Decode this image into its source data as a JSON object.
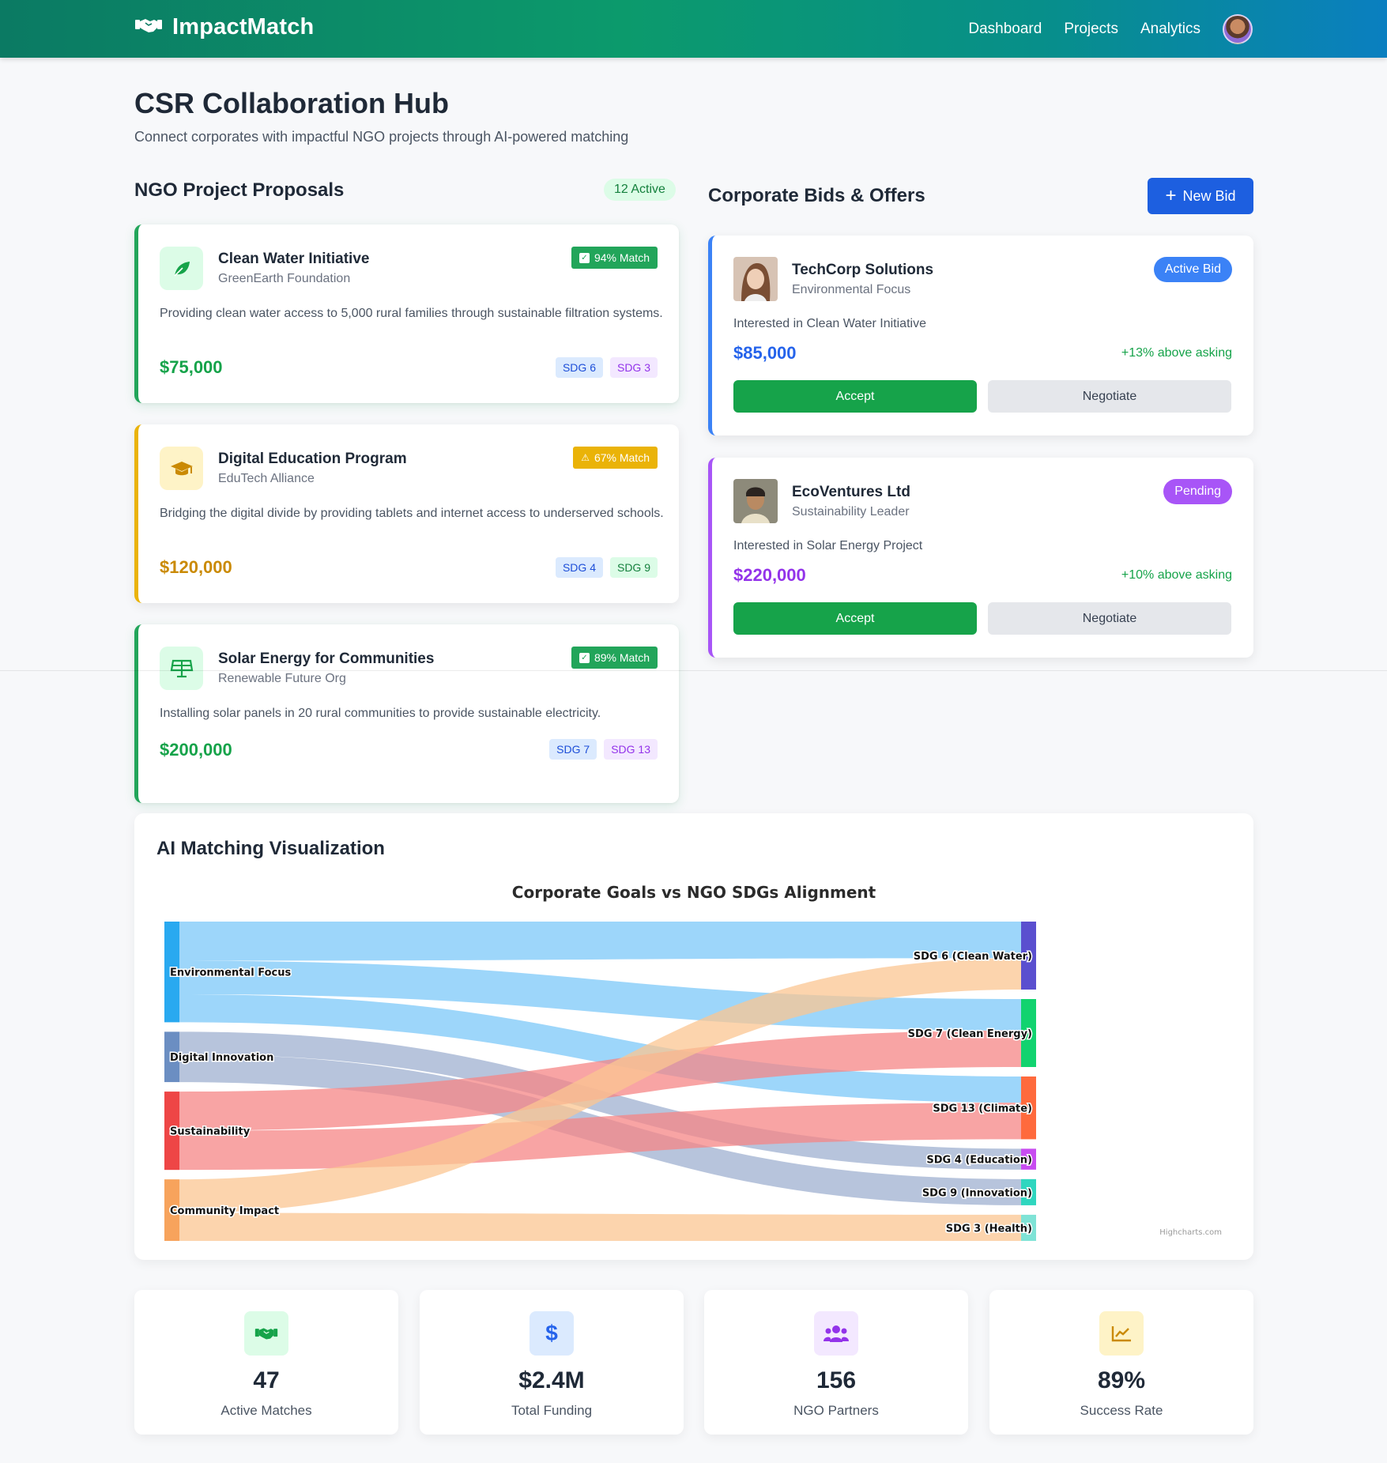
{
  "navbar": {
    "brand": "ImpactMatch",
    "links": [
      "Dashboard",
      "Projects",
      "Analytics"
    ]
  },
  "header": {
    "title": "CSR Collaboration Hub",
    "subtitle": "Connect corporates with impactful NGO projects through AI-powered matching"
  },
  "ngo_section": {
    "title": "NGO Project Proposals",
    "active_pill": "12 Active",
    "cards": [
      {
        "name": "Clean Water Initiative",
        "org": "GreenEarth Foundation",
        "match": "94% Match",
        "description": "Providing clean water access to 5,000 rural families through sustainable filtration systems.",
        "amount": "$75,000",
        "sdgs": [
          "SDG 6",
          "SDG 3"
        ],
        "accent": "#16a34a",
        "icon": "leaf-icon"
      },
      {
        "name": "Digital Education Program",
        "org": "EduTech Alliance",
        "match": "67% Match",
        "description": "Bridging the digital divide by providing tablets and internet access to underserved schools.",
        "amount": "$120,000",
        "sdgs": [
          "SDG 4",
          "SDG 9"
        ],
        "accent": "#ca8a04",
        "icon": "graduation-cap-icon"
      },
      {
        "name": "Solar Energy for Communities",
        "org": "Renewable Future Org",
        "match": "89% Match",
        "description": "Installing solar panels in 20 rural communities to provide sustainable electricity.",
        "amount": "$200,000",
        "sdgs": [
          "SDG 7",
          "SDG 13"
        ],
        "accent": "#16a34a",
        "icon": "solar-panel-icon"
      }
    ]
  },
  "bids_section": {
    "title": "Corporate Bids & Offers",
    "new_bid_label": "New Bid",
    "cards": [
      {
        "company": "TechCorp Solutions",
        "focus": "Environmental Focus",
        "status": "Active Bid",
        "interest": "Interested in Clean Water Initiative",
        "amount": "$85,000",
        "delta": "+13% above asking",
        "accept_label": "Accept",
        "negotiate_label": "Negotiate",
        "accent": "#2563eb"
      },
      {
        "company": "EcoVentures Ltd",
        "focus": "Sustainability Leader",
        "status": "Pending",
        "interest": "Interested in Solar Energy Project",
        "amount": "$220,000",
        "delta": "+10% above asking",
        "accept_label": "Accept",
        "negotiate_label": "Negotiate",
        "accent": "#9333ea"
      }
    ]
  },
  "visualization": {
    "section_title": "AI Matching Visualization",
    "credit": "Highcharts.com"
  },
  "chart_data": {
    "type": "sankey",
    "title": "Corporate Goals vs NGO SDGs Alignment",
    "nodes_left": [
      {
        "name": "Environmental Focus",
        "color": "#29a9f0"
      },
      {
        "name": "Digital Innovation",
        "color": "#6b8ec2"
      },
      {
        "name": "Sustainability",
        "color": "#ee4646"
      },
      {
        "name": "Community Impact",
        "color": "#f7a35c"
      }
    ],
    "nodes_right": [
      {
        "name": "SDG 6 (Clean Water)",
        "color": "#5a4fcf"
      },
      {
        "name": "SDG 7 (Clean Energy)",
        "color": "#12d36f"
      },
      {
        "name": "SDG 13 (Climate)",
        "color": "#ff6a3d"
      },
      {
        "name": "SDG 4 (Education)",
        "color": "#c84cf0"
      },
      {
        "name": "SDG 9 (Innovation)",
        "color": "#2fd6bf"
      },
      {
        "name": "SDG 3 (Health)",
        "color": "#7fe3d6"
      }
    ],
    "links": [
      {
        "from": "Environmental Focus",
        "to": "SDG 6 (Clean Water)",
        "value": 35
      },
      {
        "from": "Environmental Focus",
        "to": "SDG 7 (Clean Energy)",
        "value": 30
      },
      {
        "from": "Environmental Focus",
        "to": "SDG 13 (Climate)",
        "value": 25
      },
      {
        "from": "Digital Innovation",
        "to": "SDG 4 (Education)",
        "value": 20
      },
      {
        "from": "Digital Innovation",
        "to": "SDG 9 (Innovation)",
        "value": 25
      },
      {
        "from": "Sustainability",
        "to": "SDG 7 (Clean Energy)",
        "value": 35
      },
      {
        "from": "Sustainability",
        "to": "SDG 13 (Climate)",
        "value": 35
      },
      {
        "from": "Community Impact",
        "to": "SDG 6 (Clean Water)",
        "value": 30
      },
      {
        "from": "Community Impact",
        "to": "SDG 3 (Health)",
        "value": 25
      }
    ]
  },
  "stats": [
    {
      "value": "47",
      "label": "Active Matches",
      "icon": "handshake-icon"
    },
    {
      "value": "$2.4M",
      "label": "Total Funding",
      "icon": "dollar-icon"
    },
    {
      "value": "156",
      "label": "NGO Partners",
      "icon": "users-icon"
    },
    {
      "value": "89%",
      "label": "Success Rate",
      "icon": "chart-line-icon"
    }
  ]
}
